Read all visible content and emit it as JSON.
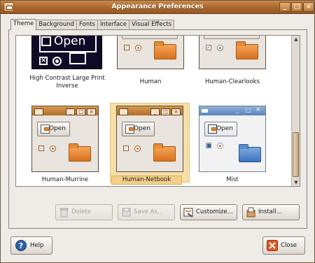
{
  "window": {
    "title": "Appearance Preferences"
  },
  "tabs": [
    {
      "label": "Theme",
      "active": true
    },
    {
      "label": "Background",
      "active": false
    },
    {
      "label": "Fonts",
      "active": false
    },
    {
      "label": "Interface",
      "active": false
    },
    {
      "label": "Visual Effects",
      "active": false
    }
  ],
  "themes": [
    {
      "name": "High Contrast Large Print Inverse",
      "preview_button": "Open"
    },
    {
      "name": "Human"
    },
    {
      "name": "Human-Clearlooks"
    },
    {
      "name": "Human-Murrine",
      "preview_button": "Open"
    },
    {
      "name": "Human-Netbook",
      "preview_button": "Open",
      "selected": true
    },
    {
      "name": "Mist",
      "preview_button": "Open"
    }
  ],
  "actions": {
    "delete": "Delete",
    "save_as": "Save As...",
    "customize": "Customize...",
    "install": "Install..."
  },
  "footer": {
    "help": "Help",
    "close": "Close"
  },
  "colors": {
    "accent": "#b06f2d",
    "selection": "#f3d089"
  }
}
